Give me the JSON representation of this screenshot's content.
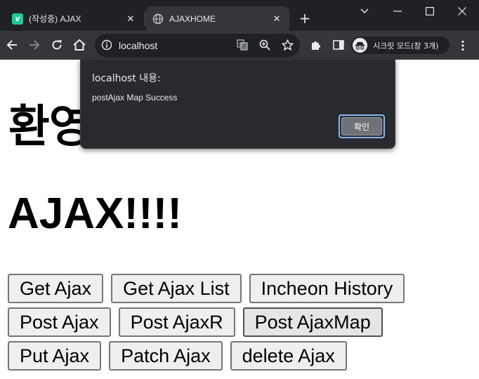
{
  "browser": {
    "tabs": [
      {
        "title": "(작성중) AJAX",
        "favicon": "v-letter-icon",
        "active": false
      },
      {
        "title": "AJAXHOME",
        "favicon": "globe-icon",
        "active": true
      }
    ],
    "new_tab_label": "+",
    "address": "localhost",
    "incognito_label": "시크릿 모드(창 3개)"
  },
  "page": {
    "heading_welcome": "환영",
    "heading_ajax": "AJAX!!!!",
    "button_rows": [
      [
        "Get Ajax",
        "Get Ajax List",
        "Incheon History"
      ],
      [
        "Post Ajax",
        "Post AjaxR",
        "Post AjaxMap"
      ],
      [
        "Put Ajax",
        "Patch Ajax",
        "delete Ajax"
      ]
    ]
  },
  "dialog": {
    "title": "localhost 내용:",
    "message": "postAjax Map Success",
    "ok_label": "확인"
  },
  "colors": {
    "chrome_dark": "#202124",
    "toolbar": "#35363a",
    "dialog_bg": "#292a2d",
    "focus_ring": "#8ab4f8",
    "favicon_green": "#1ec997"
  }
}
